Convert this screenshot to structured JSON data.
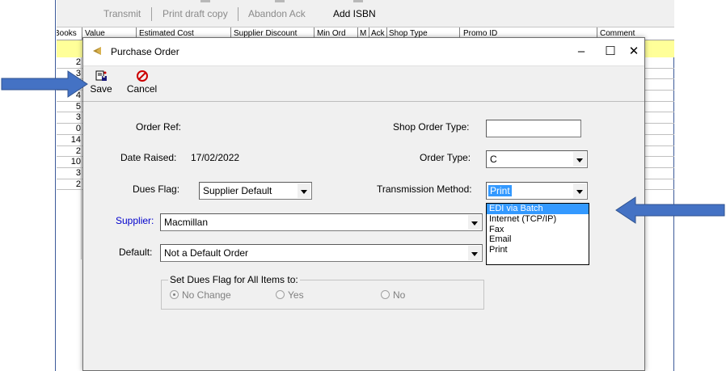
{
  "background_window": {
    "toolbar_items": [
      "Transmit",
      "Print draft copy",
      "Abandon Ack",
      "Add ISBN"
    ],
    "columns": [
      "Books",
      "Value",
      "Estimated Cost",
      "Supplier Discount",
      "Min Ord",
      "M",
      "Ack",
      "Shop Type",
      "Promo ID",
      "Comment"
    ],
    "row_values": [
      "2",
      "3",
      "2",
      "4",
      "5",
      "3",
      "0",
      "14",
      "2",
      "10",
      "3",
      "2"
    ]
  },
  "dialog": {
    "title": "Purchase Order",
    "toolbar": {
      "save_label": "Save",
      "cancel_label": "Cancel"
    },
    "fields": {
      "order_ref_label": "Order Ref:",
      "date_raised_label": "Date Raised:",
      "date_raised_value": "17/02/2022",
      "dues_flag_label": "Dues Flag:",
      "dues_flag_value": "Supplier Default",
      "supplier_label": "Supplier:",
      "supplier_value": "Macmillan",
      "default_label": "Default:",
      "default_value": "Not a Default Order",
      "shop_order_type_label": "Shop Order Type:",
      "shop_order_type_value": "",
      "order_type_label": "Order Type:",
      "order_type_value": "C",
      "transmission_method_label": "Transmission Method:",
      "transmission_method_value": "Print"
    },
    "transmission_options": [
      "EDI via Batch",
      "Internet (TCP/IP)",
      "Fax",
      "Email",
      "Print"
    ],
    "transmission_highlighted": "EDI via Batch",
    "dues_group": {
      "legend": "Set Dues Flag for All Items to:",
      "options": [
        "No Change",
        "Yes",
        "No"
      ],
      "selected": "No Change"
    }
  },
  "colors": {
    "selection": "#3399ff",
    "annotation_arrow": "#4472c4",
    "grid_highlight": "#ffff99",
    "supplier_label": "#0000cc"
  }
}
